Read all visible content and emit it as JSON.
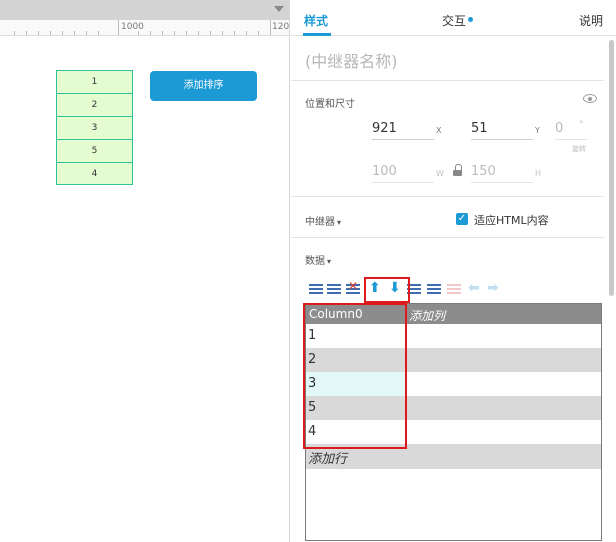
{
  "canvas": {
    "ruler_labels": [
      "1000",
      "120"
    ],
    "repeater_rows": [
      "1",
      "2",
      "3",
      "5",
      "4"
    ],
    "sort_button_label": "添加排序"
  },
  "inspector": {
    "tabs": [
      {
        "label": "样式",
        "active": true
      },
      {
        "label": "交互",
        "has_dot": true
      },
      {
        "label": "说明"
      }
    ],
    "repeater_name_placeholder": "(中继器名称)",
    "position_size": {
      "title": "位置和尺寸",
      "x": "921",
      "x_label": "X",
      "y": "51",
      "y_label": "Y",
      "rotation": "0",
      "rotation_unit": "°",
      "rotation_label": "旋转",
      "w": "100",
      "w_label": "W",
      "h": "150",
      "h_label": "H"
    },
    "repeater_section": {
      "title": "中继器",
      "fit_html_label": "适应HTML内容",
      "fit_html_checked": true
    },
    "data_section": {
      "title": "数据",
      "toolbar_icons": [
        "insert-row-above-icon",
        "insert-row-below-icon",
        "delete-row-icon",
        "move-up-icon",
        "move-down-icon",
        "insert-column-left-icon",
        "insert-column-right-icon",
        "delete-column-icon",
        "move-left-icon",
        "move-right-icon"
      ],
      "column_header": "Column0",
      "add_column_label": "添加列",
      "rows": [
        "1",
        "2",
        "3",
        "5",
        "4"
      ],
      "add_row_label": "添加行"
    }
  },
  "colors": {
    "accent": "#1b9ad6",
    "highlight_red": "#e01a1a",
    "cell_green": "#e5fbd0",
    "cell_border": "#2fc29a",
    "row_gray": "#d9d9d9",
    "selected_row": "#e3f9f9"
  }
}
